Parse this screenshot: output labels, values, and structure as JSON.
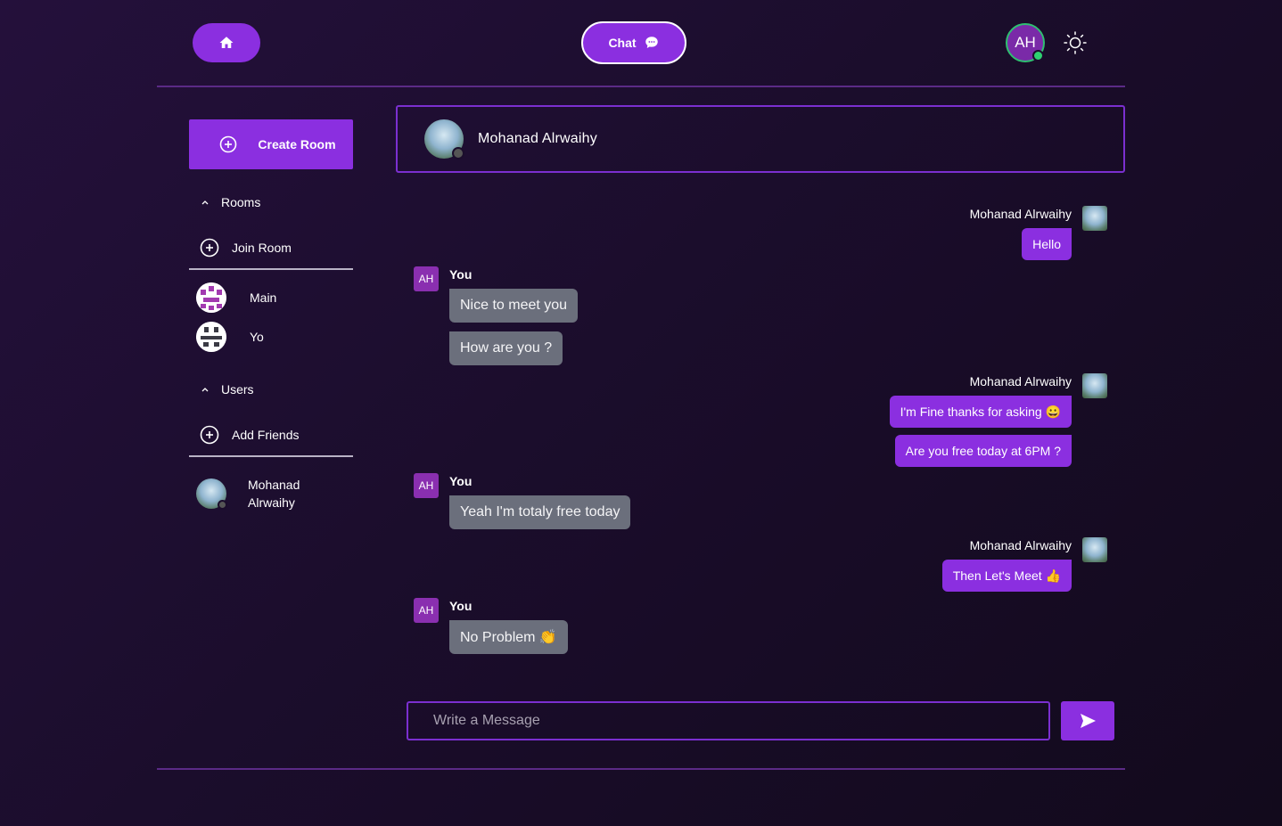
{
  "colors": {
    "accent": "#8b2fe0",
    "online": "#2fd171",
    "bubble_other": "#6b6f7c",
    "background": "#1b0d2c"
  },
  "topbar": {
    "home_icon": "home-icon",
    "chat_button_label": "Chat",
    "chat_icon": "chat-bubble-icon",
    "user_initials": "AH",
    "theme_icon": "sun-icon"
  },
  "sidebar": {
    "create_room_label": "Create Room",
    "rooms_heading": "Rooms",
    "join_room_label": "Join Room",
    "rooms": [
      {
        "name": "Main"
      },
      {
        "name": "Yo"
      }
    ],
    "users_heading": "Users",
    "add_friends_label": "Add Friends",
    "users": [
      {
        "name": "Mohanad Alrwaihy"
      }
    ]
  },
  "chat": {
    "contact_name": "Mohanad Alrwaihy",
    "groups": [
      {
        "side": "other",
        "sender": "Mohanad Alrwaihy",
        "messages": [
          "Hello"
        ]
      },
      {
        "side": "me",
        "initials": "AH",
        "sender": "You",
        "messages": [
          "Nice to meet you",
          "How are you ?"
        ]
      },
      {
        "side": "other",
        "sender": "Mohanad Alrwaihy",
        "messages": [
          "I'm Fine thanks for asking 😀",
          "Are you free today at 6PM ?"
        ]
      },
      {
        "side": "me",
        "initials": "AH",
        "sender": "You",
        "messages": [
          "Yeah I'm totaly free today"
        ]
      },
      {
        "side": "other",
        "sender": "Mohanad Alrwaihy",
        "messages": [
          "Then Let's Meet 👍"
        ]
      },
      {
        "side": "me",
        "initials": "AH",
        "sender": "You",
        "messages": [
          "No Problem 👏"
        ]
      }
    ]
  },
  "composer": {
    "placeholder": "Write a Message",
    "value": "",
    "send_icon": "send-icon"
  }
}
